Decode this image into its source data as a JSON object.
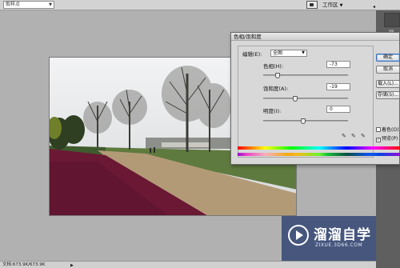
{
  "options_bar": {
    "sample_value": "取样点",
    "workspace_label": "工作区"
  },
  "status_bar": {
    "doc_text": "文档:673.9K/673.9K"
  },
  "hue_saturation_dialog": {
    "title": "色相/饱和度",
    "edit_label": "编辑(E):",
    "edit_value": "全图",
    "hue": {
      "label": "色相(H):",
      "value": "-73"
    },
    "saturation": {
      "label": "饱和度(A):",
      "value": "-19"
    },
    "lightness": {
      "label": "明度(I):",
      "value": "0"
    },
    "buttons": {
      "ok": "确定",
      "cancel": "取消",
      "load": "载入(L)...",
      "save": "存储(S)..."
    },
    "colorize": {
      "label": "着色(O)",
      "checked": false
    },
    "preview": {
      "label": "预览(P)",
      "checked": true
    }
  },
  "watermark": {
    "title": "溜溜自学",
    "url": "ZIXUE.3D66.COM"
  }
}
